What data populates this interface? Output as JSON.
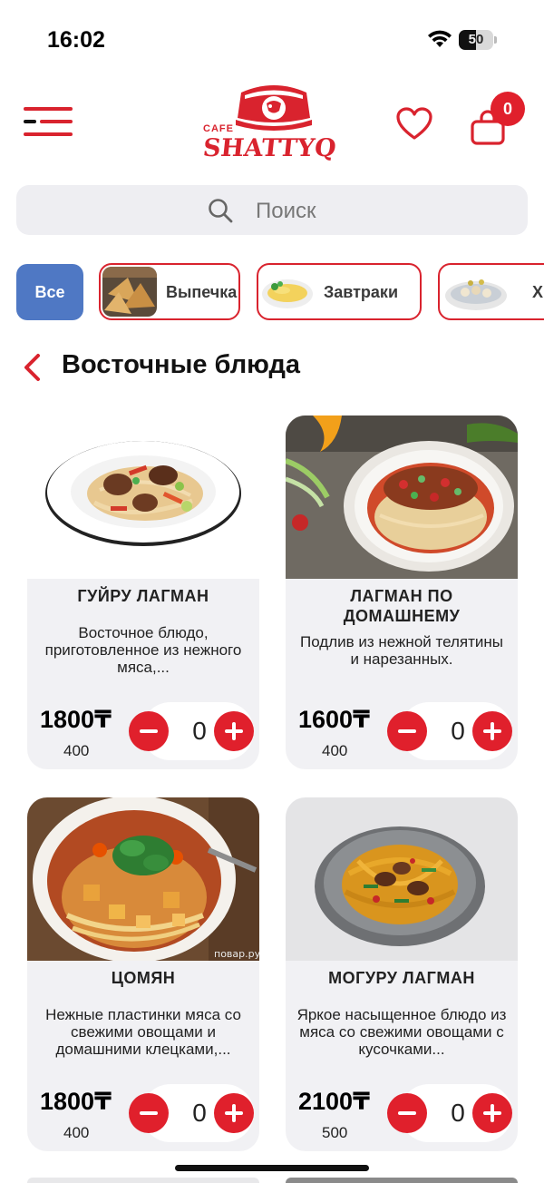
{
  "status_bar": {
    "time": "16:02",
    "battery": "50",
    "battery_level": 0.5
  },
  "header": {
    "logo_small": "CAFE",
    "logo_name": "SHATTYQ",
    "cart_count": "0",
    "icons": [
      "menu-icon",
      "heart-icon",
      "shopping-bag-icon"
    ]
  },
  "search": {
    "placeholder": "Поиск"
  },
  "categories": [
    {
      "label": "Все",
      "active": true
    },
    {
      "label": "Выпечка"
    },
    {
      "label": "Завтраки"
    },
    {
      "label": "Х"
    }
  ],
  "section": {
    "title": "Восточные блюда"
  },
  "products": [
    {
      "name": "ГУЙРУ ЛАГМАН",
      "description": "Восточное блюдо, приготовленное из нежного мяса,...",
      "price": "1800₸",
      "weight": "400",
      "quantity": "0"
    },
    {
      "name": "ЛАГМАН ПО ДОМАШНЕМУ",
      "description": "Подлив из нежной телятины и нарезанных.",
      "price": "1600₸",
      "weight": "400",
      "quantity": "0"
    },
    {
      "name": "ЦОМЯН",
      "description": "Нежные пластинки мяса со свежими овощами и домашними клецками,...",
      "price": "1800₸",
      "weight": "400",
      "quantity": "0"
    },
    {
      "name": "МОГУРУ ЛАГМАН",
      "description": "Яркое насыщенное блюдо из мяса со свежими овощами с кусочками...",
      "price": "2100₸",
      "weight": "500",
      "quantity": "0"
    }
  ],
  "image_watermark": "повар.ру",
  "colors": {
    "accent": "#e0202c",
    "chip_active": "#4f78c4",
    "card_bg": "#f1f1f4"
  }
}
